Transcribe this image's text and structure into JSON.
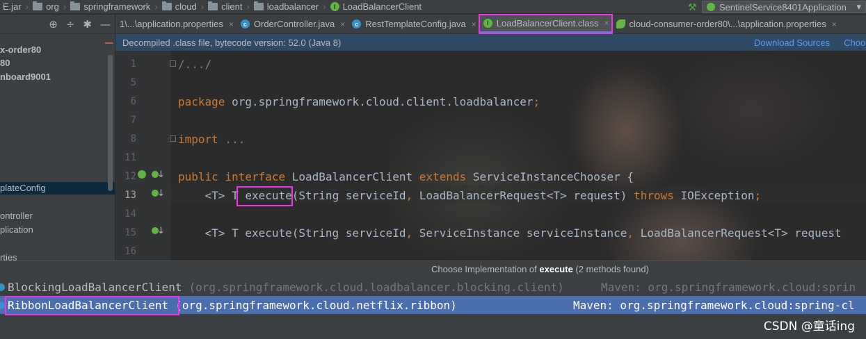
{
  "navbar": {
    "crumbs": [
      "E.jar",
      "org",
      "springframework",
      "cloud",
      "client",
      "loadbalancer",
      "LoadBalancerClient"
    ],
    "run_config": "SentinelService8401Application"
  },
  "project": {
    "items": [
      "x-order80",
      "80",
      "nboard9001",
      "plateConfig",
      "ontroller",
      "plication",
      "rties"
    ]
  },
  "tabs": [
    {
      "label": "1\\...\\application.properties"
    },
    {
      "label": "OrderController.java"
    },
    {
      "label": "RestTemplateConfig.java"
    },
    {
      "label": "LoadBalancerClient.class"
    },
    {
      "label": "cloud-consumer-order80\\...\\application.properties"
    }
  ],
  "infobar": {
    "message": "Decompiled .class file, bytecode version: 52.0 (Java 8)",
    "download_sources": "Download Sources",
    "choose_sources": "Choo"
  },
  "editor": {
    "line_numbers": [
      "1",
      "5",
      "6",
      "7",
      "8",
      "11",
      "12",
      "13",
      "14",
      "15",
      "16"
    ],
    "line1": "/.../",
    "line6_kw": "package",
    "line6_rest": " org.springframework.cloud.client.loadbalancer",
    "line6_semi": ";",
    "line8_kw": "import",
    "line8_rest": " ...",
    "line12_kw1": "public",
    "line12_kw2": "interface",
    "line12_name": " LoadBalancerClient ",
    "line12_kw3": "extends",
    "line12_rest": " ServiceInstanceChooser {",
    "line13_pre": "    <T> T ",
    "line13_method": "execute",
    "line13_args": "(String serviceId",
    "line13_comma": ",",
    "line13_args2": " LoadBalancerRequest<T> request) ",
    "line13_throws": "throws",
    "line13_exc": " IOException",
    "line13_semi": ";",
    "line15_pre": "    <T> T execute(String serviceId",
    "line15_comma": ",",
    "line15_mid": " ServiceInstance serviceInstance",
    "line15_comma2": ",",
    "line15_end": " LoadBalancerRequest<T> request"
  },
  "popup": {
    "title_prefix": "Choose Implementation of ",
    "title_method": "execute",
    "title_suffix": " (2 methods found)",
    "items": [
      {
        "name": "BlockingLoadBalancerClient",
        "pkg": "(org.springframework.cloud.loadbalancer.blocking.client)",
        "maven": "Maven: org.springframework.cloud:sprin"
      },
      {
        "name": "RibbonLoadBalancerClient",
        "pkg": "(org.springframework.cloud.netflix.ribbon)",
        "maven": "Maven: org.springframework.cloud:spring-cl"
      }
    ]
  },
  "watermark": "CSDN @童话ing",
  "colors": {
    "accent_highlight": "#ee33ee",
    "selection": "#4b6eaf",
    "keyword": "#cc7832",
    "text": "#a9b7c6"
  }
}
